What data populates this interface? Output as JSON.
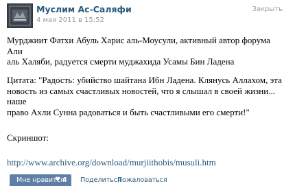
{
  "post": {
    "author": "Муслим Ас-Саляфи",
    "date": "4 мая 2011 в 15:52",
    "close_label": "Закрыть",
    "line1a": "Мурджиит Фатхи Абуль Харис аль-Моусули, активный автор форума Али",
    "line1b": "аль Халяби, радуется смерти муджахида Усамы Бин Ладена",
    "line2a": "Цитата: \"Радость: убийство шайтана Ибн Ладена. Клянусь Аллахом, эта",
    "line2b": "новость из самых счастливых новостей, что я слышал в своей жизни...",
    "line2c": "наше",
    "line2d": "право Ахли Сунна радоваться и быть счастливыми его смерти!\"",
    "screenshot_label": "Скриншот:",
    "link": "http://www.archive.org/download/murjiithobis/musuli.htm"
  },
  "footer": {
    "like_label": "Мне нравится",
    "like_count": "4",
    "share_label": "Поделиться",
    "report_label": "Пожаловаться"
  },
  "icons": {
    "avatar": "avatar-image",
    "like": "heart-icon"
  },
  "colors": {
    "accent": "#2b587a",
    "like_button": "#5f7fa6"
  }
}
